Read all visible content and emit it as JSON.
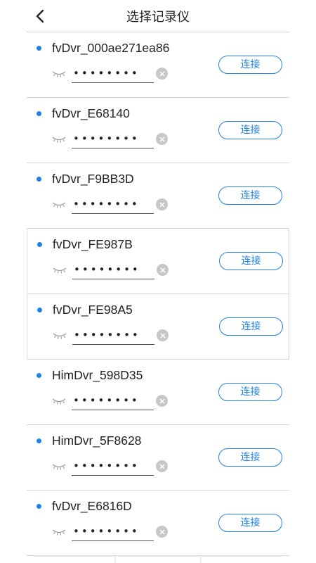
{
  "header": {
    "title": "选择记录仪",
    "back_icon": "chevron-left-icon"
  },
  "colors": {
    "accent": "#1e82e6",
    "divider": "#d8d8d8",
    "clear_icon_bg": "#c7c7c7"
  },
  "devices": [
    {
      "ssid": "fvDvr_000ae271ea86",
      "password": "12345678",
      "connect_label": "连接"
    },
    {
      "ssid": "fvDvr_E68140",
      "password": "12345678",
      "connect_label": "连接"
    },
    {
      "ssid": "fvDvr_F9BB3D",
      "password": "12345678",
      "connect_label": "连接"
    },
    {
      "ssid": "fvDvr_FE987B",
      "password": "12345678",
      "connect_label": "连接"
    },
    {
      "ssid": "fvDvr_FE98A5",
      "password": "12345678",
      "connect_label": "连接"
    },
    {
      "ssid": "HimDvr_598D35",
      "password": "12345678",
      "connect_label": "连接"
    },
    {
      "ssid": "HimDvr_5F8628",
      "password": "12345678",
      "connect_label": "连接"
    },
    {
      "ssid": "fvDvr_E6816D",
      "password": "12345678",
      "connect_label": "连接"
    }
  ]
}
